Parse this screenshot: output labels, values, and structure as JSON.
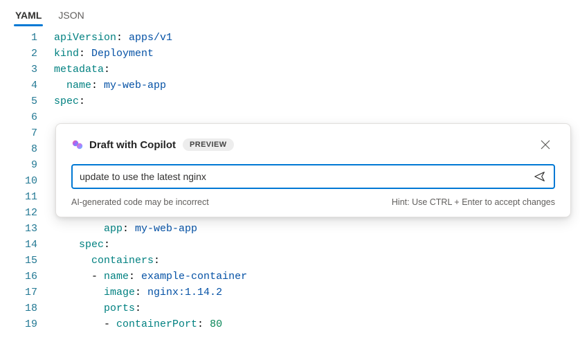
{
  "tabs": {
    "yaml": "YAML",
    "json": "JSON"
  },
  "code": {
    "lines": [
      {
        "n": 1,
        "tokens": [
          {
            "t": "apiVersion",
            "c": "key"
          },
          {
            "t": ": ",
            "c": "punct"
          },
          {
            "t": "apps/v1",
            "c": "val"
          }
        ]
      },
      {
        "n": 2,
        "tokens": [
          {
            "t": "kind",
            "c": "key"
          },
          {
            "t": ": ",
            "c": "punct"
          },
          {
            "t": "Deployment",
            "c": "val"
          }
        ]
      },
      {
        "n": 3,
        "tokens": [
          {
            "t": "metadata",
            "c": "key"
          },
          {
            "t": ":",
            "c": "punct"
          }
        ]
      },
      {
        "n": 4,
        "tokens": [
          {
            "t": "  ",
            "c": "punct"
          },
          {
            "t": "name",
            "c": "key"
          },
          {
            "t": ": ",
            "c": "punct"
          },
          {
            "t": "my-web-app",
            "c": "val"
          }
        ]
      },
      {
        "n": 5,
        "tokens": [
          {
            "t": "spec",
            "c": "key"
          },
          {
            "t": ":",
            "c": "punct"
          }
        ]
      },
      {
        "n": 6,
        "tokens": []
      },
      {
        "n": 7,
        "tokens": []
      },
      {
        "n": 8,
        "tokens": []
      },
      {
        "n": 9,
        "tokens": []
      },
      {
        "n": 10,
        "tokens": []
      },
      {
        "n": 11,
        "tokens": []
      },
      {
        "n": 12,
        "tokens": []
      },
      {
        "n": 13,
        "tokens": [
          {
            "t": "        ",
            "c": "punct"
          },
          {
            "t": "app",
            "c": "key"
          },
          {
            "t": ": ",
            "c": "punct"
          },
          {
            "t": "my-web-app",
            "c": "val"
          }
        ]
      },
      {
        "n": 14,
        "tokens": [
          {
            "t": "    ",
            "c": "punct"
          },
          {
            "t": "spec",
            "c": "key"
          },
          {
            "t": ":",
            "c": "punct"
          }
        ]
      },
      {
        "n": 15,
        "tokens": [
          {
            "t": "      ",
            "c": "punct"
          },
          {
            "t": "containers",
            "c": "key"
          },
          {
            "t": ":",
            "c": "punct"
          }
        ]
      },
      {
        "n": 16,
        "tokens": [
          {
            "t": "      - ",
            "c": "dash"
          },
          {
            "t": "name",
            "c": "key"
          },
          {
            "t": ": ",
            "c": "punct"
          },
          {
            "t": "example-container",
            "c": "val"
          }
        ]
      },
      {
        "n": 17,
        "tokens": [
          {
            "t": "        ",
            "c": "punct"
          },
          {
            "t": "image",
            "c": "key"
          },
          {
            "t": ": ",
            "c": "punct"
          },
          {
            "t": "nginx:1.14.2",
            "c": "val"
          }
        ]
      },
      {
        "n": 18,
        "tokens": [
          {
            "t": "        ",
            "c": "punct"
          },
          {
            "t": "ports",
            "c": "key"
          },
          {
            "t": ":",
            "c": "punct"
          }
        ]
      },
      {
        "n": 19,
        "tokens": [
          {
            "t": "        - ",
            "c": "dash"
          },
          {
            "t": "containerPort",
            "c": "key"
          },
          {
            "t": ": ",
            "c": "punct"
          },
          {
            "t": "80",
            "c": "num"
          }
        ]
      }
    ]
  },
  "popup": {
    "title": "Draft with Copilot",
    "badge": "PREVIEW",
    "input_value": "update to use the latest nginx",
    "disclaimer": "AI-generated code may be incorrect",
    "hint": "Hint: Use CTRL + Enter to accept changes"
  }
}
